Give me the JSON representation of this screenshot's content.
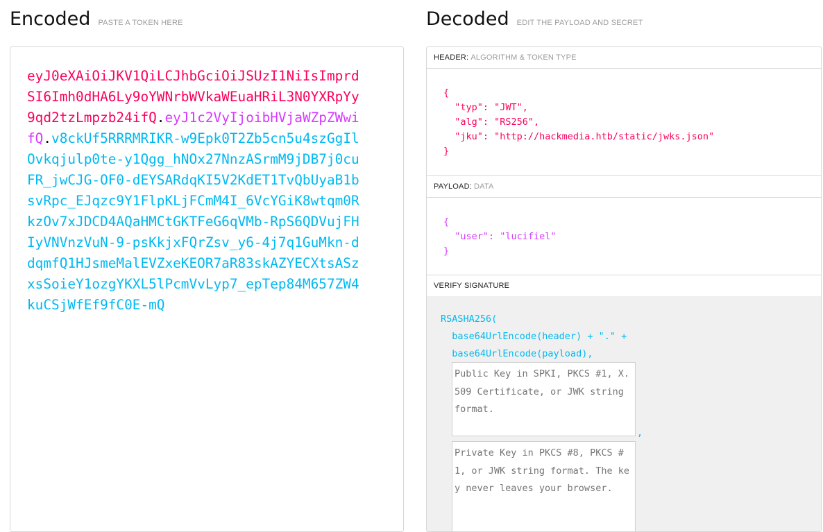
{
  "encoded": {
    "title": "Encoded",
    "subtitle": "PASTE A TOKEN HERE",
    "token_header": "eyJ0eXAiOiJKV1QiLCJhbGciOiJSUzI1NiIsImprdSI6Imh0dHA6Ly9oYWNrbWVkaWEuaHRiL3N0YXRpYy9qd2tzLmpzb24ifQ",
    "token_payload": "eyJ1c2VyIjoibHVjaWZpZWwifQ",
    "token_signature": "v8ckUf5RRRMRIKR-w9Epk0T2Zb5cn5u4szGgIlOvkqjulp0te-y1Qgg_hNOx27NnzASrmM9jDB7j0cuFR_jwCJG-OF0-dEYSARdqKI5V2KdET1TvQbUyaB1bsvRpc_EJqzc9Y1FlpKLjFCmM4I_6VcYGiK8wtqm0RkzOv7xJDCD4AQaHMCtGKTFeG6qVMb-RpS6QDVujFHIyVNVnzVuN-9-psKkjxFQrZsv_y6-4j7q1GuMkn-ddqmfQ1HJsmeMalEVZxeKEOR7aR83skAZYECXtsASzxsSoieY1ozgYKXL5lPcmVvLyp7_epTep84M657ZW4kuCSjWfEf9fC0E-mQ",
    "dot": "."
  },
  "decoded": {
    "title": "Decoded",
    "subtitle": "EDIT THE PAYLOAD AND SECRET",
    "header_section": {
      "label": "HEADER:",
      "sublabel": "ALGORITHM & TOKEN TYPE",
      "json": "{\n  \"typ\": \"JWT\",\n  \"alg\": \"RS256\",\n  \"jku\": \"http://hackmedia.htb/static/jwks.json\"\n}"
    },
    "payload_section": {
      "label": "PAYLOAD:",
      "sublabel": "DATA",
      "json": "{\n  \"user\": \"lucifiel\"\n}"
    },
    "signature_section": {
      "label": "VERIFY SIGNATURE",
      "fn_open": "RSASHA256(",
      "line2": "  base64UrlEncode(header) + \".\" +",
      "line3": "  base64UrlEncode(payload),",
      "comma": ",",
      "public_key_placeholder": "Public Key in SPKI, PKCS #1, X.509 Certificate, or JWK string format.",
      "private_key_placeholder": "Private Key in PKCS #8, PKCS #1, or JWK string format. The key never leaves your browser."
    }
  },
  "colors": {
    "header": "#fb015b",
    "payload": "#d63aff",
    "signature": "#00b9f1"
  }
}
